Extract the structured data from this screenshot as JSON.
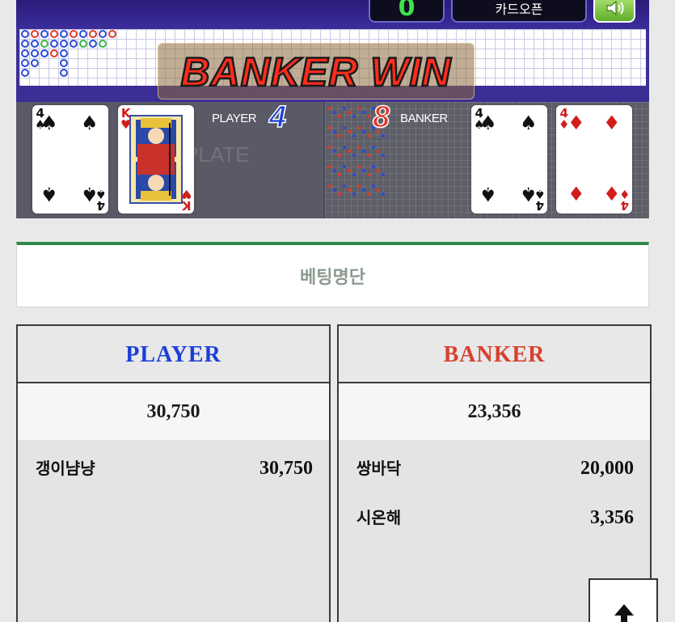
{
  "game": {
    "counter": "0",
    "card_button_label": "카드오픈",
    "result_banner": "BANKER WIN",
    "ghost_text": "PLATE",
    "player": {
      "label": "PLAYER",
      "score": "4",
      "cards": [
        {
          "rank": "4",
          "suit": "♠",
          "color": "black"
        },
        {
          "rank": "K",
          "suit": "♥",
          "color": "red"
        }
      ]
    },
    "banker": {
      "label": "BANKER",
      "score": "8",
      "cards": [
        {
          "rank": "4",
          "suit": "♠",
          "color": "black"
        },
        {
          "rank": "4",
          "suit": "♦",
          "color": "red"
        }
      ]
    },
    "icons": {
      "sound": "speaker-icon"
    },
    "colors": {
      "player": "#1a3fd8",
      "banker": "#e03a2a",
      "win_text": "#ff2c1c",
      "counter": "#3fe24a",
      "accent": "#2f8a4a"
    }
  },
  "betting_list": {
    "title": "베팅명단",
    "player": {
      "heading": "PLAYER",
      "total": "30,750",
      "bets": [
        {
          "name": "갱이냠냥",
          "amount": "30,750"
        }
      ]
    },
    "banker": {
      "heading": "BANKER",
      "total": "23,356",
      "bets": [
        {
          "name": "쌍바닥",
          "amount": "20,000"
        },
        {
          "name": "시온해",
          "amount": "3,356"
        }
      ]
    }
  },
  "scroll_top": {
    "icon": "arrow-up-icon"
  }
}
